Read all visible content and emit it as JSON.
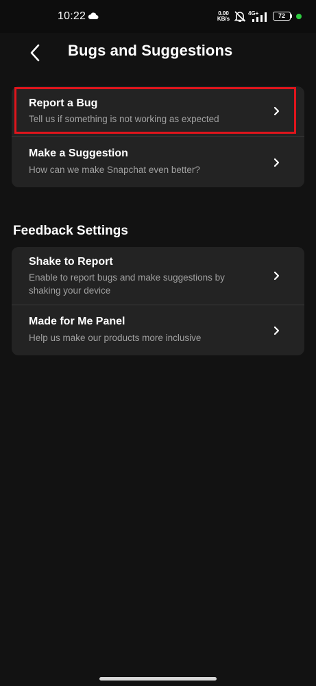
{
  "status_bar": {
    "time": "10:22",
    "net_speed_value": "0.00",
    "net_speed_unit": "KB/s",
    "network_type": "4G+",
    "battery": "72"
  },
  "header": {
    "title": "Bugs and Suggestions"
  },
  "feedback_card": {
    "items": [
      {
        "title": "Report a Bug",
        "subtitle": "Tell us if something is not working as expected"
      },
      {
        "title": "Make a Suggestion",
        "subtitle": "How can we make Snapchat even better?"
      }
    ]
  },
  "settings_section": {
    "title": "Feedback Settings",
    "items": [
      {
        "title": "Shake to Report",
        "subtitle": "Enable to report bugs and make suggestions by shaking your device"
      },
      {
        "title": "Made for Me Panel",
        "subtitle": "Help us make our products more inclusive"
      }
    ]
  },
  "colors": {
    "background": "#121212",
    "card": "#232323",
    "highlight": "#e0151c",
    "subtitle_text": "#a0a0a0",
    "status_dot": "#2ecc40"
  },
  "icons": [
    "cloud-icon",
    "mute-icon",
    "signal-icon",
    "battery-icon",
    "back-arrow-icon",
    "chevron-right-icon"
  ]
}
